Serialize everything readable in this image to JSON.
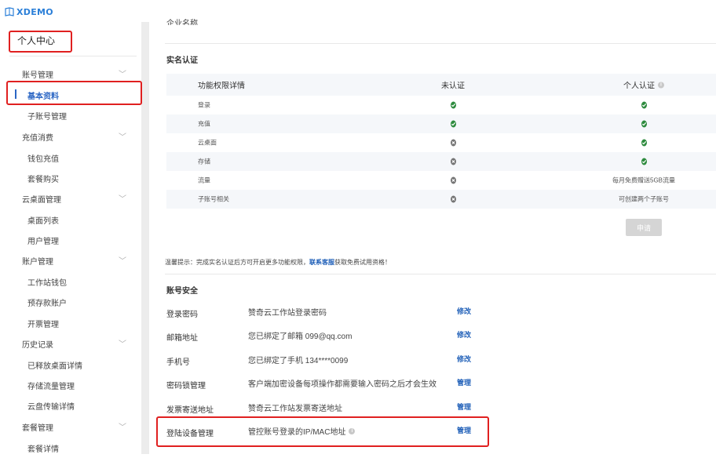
{
  "app": {
    "logo_text": "XDEMO"
  },
  "sidebar": {
    "personal_center": "个人中心",
    "groups": [
      {
        "label": "账号管理",
        "items": [
          "基本资料",
          "子账号管理"
        ]
      },
      {
        "label": "充值消费",
        "items": [
          "钱包充值",
          "套餐购买"
        ]
      },
      {
        "label": "云桌面管理",
        "items": [
          "桌面列表",
          "用户管理"
        ]
      },
      {
        "label": "账户管理",
        "items": [
          "工作站钱包",
          "预存款账户",
          "开票管理"
        ]
      },
      {
        "label": "历史记录",
        "items": [
          "已释放桌面详情",
          "存储流量管理",
          "云盘传输详情"
        ]
      },
      {
        "label": "套餐管理",
        "items": [
          "套餐详情"
        ]
      }
    ],
    "active_item": "基本资料"
  },
  "main": {
    "cut_label": "企业名称",
    "realname": {
      "title": "实名认证",
      "headers": [
        "功能权限详情",
        "未认证",
        "个人认证"
      ],
      "rows": [
        {
          "name": "登录",
          "unverified": "check",
          "personal": "check"
        },
        {
          "name": "充值",
          "unverified": "check",
          "personal": "check"
        },
        {
          "name": "云桌面",
          "unverified": "cross",
          "personal": "check"
        },
        {
          "name": "存储",
          "unverified": "cross",
          "personal": "check"
        },
        {
          "name": "流量",
          "unverified": "cross",
          "personal_text": "每月免费赠送5GB流量"
        },
        {
          "name": "子账号相关",
          "unverified": "cross",
          "personal_text": "可创建两个子账号"
        }
      ],
      "apply_button": "申请"
    },
    "tip": {
      "prefix": "温馨提示：完成实名认证后方可开启更多功能权限，",
      "link": "联系客服",
      "suffix": "获取免费试用资格！"
    },
    "security": {
      "title": "账号安全",
      "rows": [
        {
          "label": "登录密码",
          "desc": "赞奇云工作站登录密码",
          "action": "修改"
        },
        {
          "label": "邮箱地址",
          "desc": "您已绑定了邮箱 099@qq.com",
          "action": "修改"
        },
        {
          "label": "手机号",
          "desc": "您已绑定了手机 134****0099",
          "action": "修改"
        },
        {
          "label": "密码锁管理",
          "desc": "客户端加密设备每项操作都需要输入密码之后才会生效",
          "action": "管理"
        },
        {
          "label": "发票寄送地址",
          "desc": "赞奇云工作站发票寄送地址",
          "action": "管理"
        },
        {
          "label": "登陆设备管理",
          "desc": "管控账号登录的IP/MAC地址",
          "action": "管理"
        }
      ]
    }
  },
  "colors": {
    "accent": "#1f5fb8",
    "success": "#2e8b3e",
    "disabled": "#757575",
    "highlight": "#e02020"
  }
}
